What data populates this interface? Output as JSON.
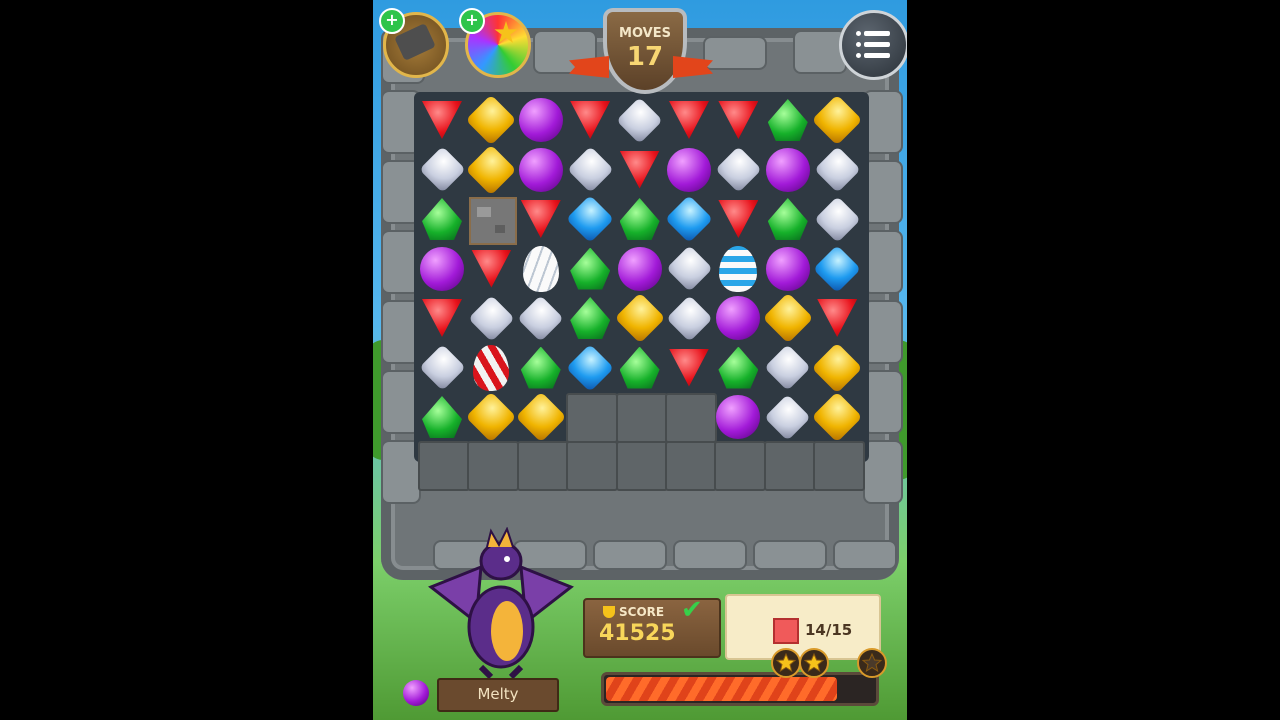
{
  "hud": {
    "moves_label": "MOVES",
    "moves_value": "17",
    "menu_icon": "menu-icon",
    "boosters": [
      "hammer-booster-icon",
      "rainbow-booster-icon"
    ]
  },
  "board": {
    "grid": [
      [
        "red",
        "amber",
        "purple",
        "red",
        "silver",
        "red",
        "red",
        "green",
        "amber"
      ],
      [
        "silver",
        "amber",
        "purple",
        "silver",
        "red",
        "purple",
        "silver",
        "purple",
        "silver"
      ],
      [
        "green",
        "rocks",
        "red",
        "blue",
        "green",
        "blue",
        "red",
        "green",
        "silver"
      ],
      [
        "purple",
        "red",
        "egg-white",
        "green",
        "purple",
        "silver",
        "egg-blue",
        "purple",
        "blue"
      ],
      [
        "red",
        "silver",
        "silver",
        "green",
        "amber",
        "silver",
        "purple",
        "amber",
        "red"
      ],
      [
        "silver",
        "egg-red",
        "green",
        "blue",
        "green",
        "red",
        "green",
        "silver",
        "amber"
      ],
      [
        "green",
        "amber",
        "amber",
        "block",
        "block",
        "block",
        "purple",
        "silver",
        "amber"
      ]
    ]
  },
  "hero": {
    "name": "Melty",
    "gem_color": "#a21ad8"
  },
  "score": {
    "label": "SCORE",
    "value": "41525"
  },
  "goal": {
    "text": "14/15",
    "color": "#f05a5a"
  },
  "progress": {
    "fraction": 0.85,
    "stars_earned": 2,
    "stars_total": 3
  }
}
